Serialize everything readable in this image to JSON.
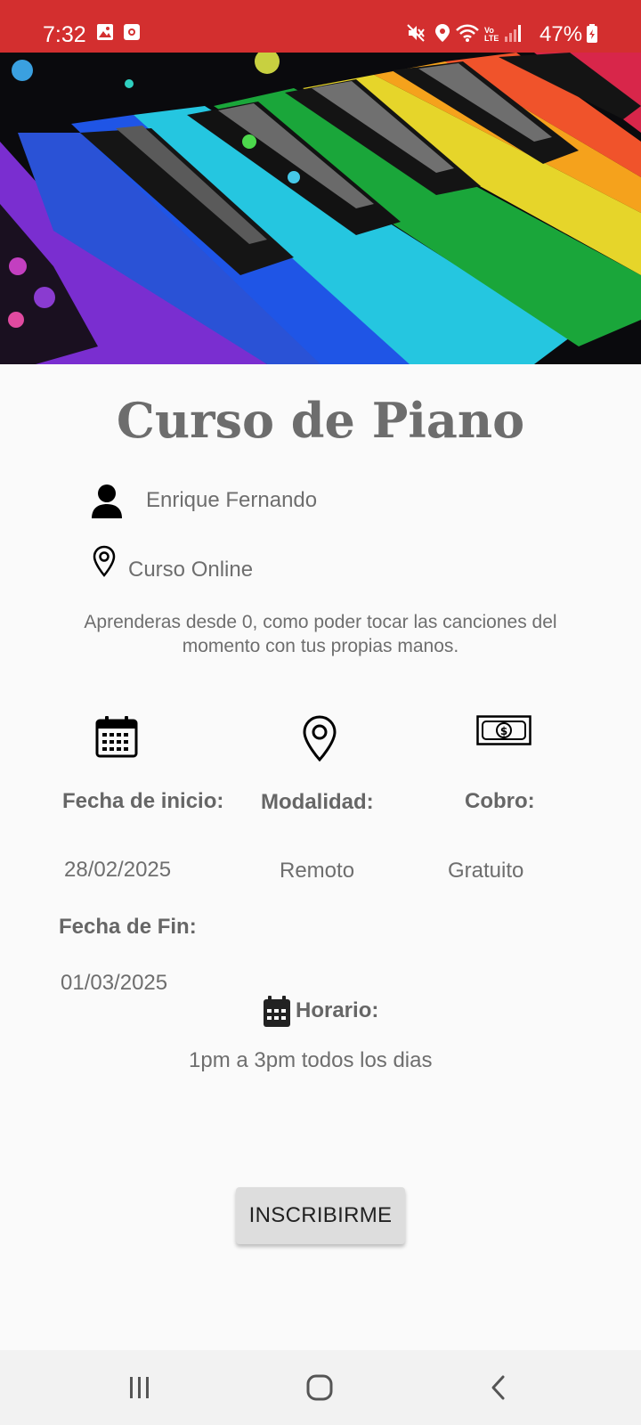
{
  "status_bar": {
    "time": "7:32",
    "battery": "47%",
    "icons": [
      "image-notification-icon",
      "calendar-notification-icon",
      "mute-icon",
      "location-icon",
      "wifi-icon",
      "volte-icon",
      "signal-icon",
      "battery-icon"
    ],
    "background": "#d32f2f"
  },
  "hero": {
    "image_icon": "rainbow-piano-keys-image"
  },
  "course": {
    "title": "Curso de Piano",
    "instructor": "Enrique Fernando",
    "location": "Curso Online",
    "description": "Aprenderas desde 0, como poder tocar las canciones del momento con tus propias manos."
  },
  "details": {
    "start_label": "Fecha de inicio:",
    "start_value": "28/02/2025",
    "mode_label": "Modalidad:",
    "mode_value": "Remoto",
    "cost_label": "Cobro:",
    "cost_value": "Gratuito",
    "end_label": "Fecha de Fin:",
    "end_value": "01/03/2025",
    "schedule_label": "Horario:",
    "schedule_value": "1pm a 3pm todos los dias"
  },
  "actions": {
    "enroll_label": "INSCRIBIRME"
  },
  "nav": {
    "icons": [
      "recent-apps-icon",
      "home-icon",
      "back-icon"
    ]
  }
}
